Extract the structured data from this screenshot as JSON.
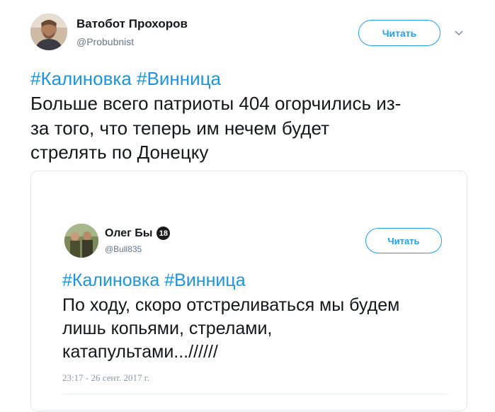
{
  "tweet": {
    "author_name": "Ватобот Прохоров",
    "author_handle": "@Probubnist",
    "follow_label": "Читать",
    "hashtags": [
      "#Калиновка",
      "#Винница"
    ],
    "text_lines": [
      "Больше всего патриоты 404 огорчились из-",
      "за того, что теперь им нечем будет",
      "стрелять по Донецку"
    ]
  },
  "quoted": {
    "author_name": "Олег Бы",
    "badge": "18",
    "author_handle": "@Bull835",
    "follow_label": "Читать",
    "hashtags": [
      "#Калиновка",
      "#Винница"
    ],
    "text_lines": [
      "По ходу, скоро отстреливаться мы будем",
      "лишь копьями, стрелами,",
      "катапультами...//////"
    ],
    "timestamp": "23:17 - 26 сент. 2017 г."
  },
  "colors": {
    "accent": "#1da1f2",
    "hashtag": "#1b95e0",
    "text": "#14171a",
    "muted": "#657786"
  },
  "icons": {
    "menu": "chevron-down-icon"
  }
}
